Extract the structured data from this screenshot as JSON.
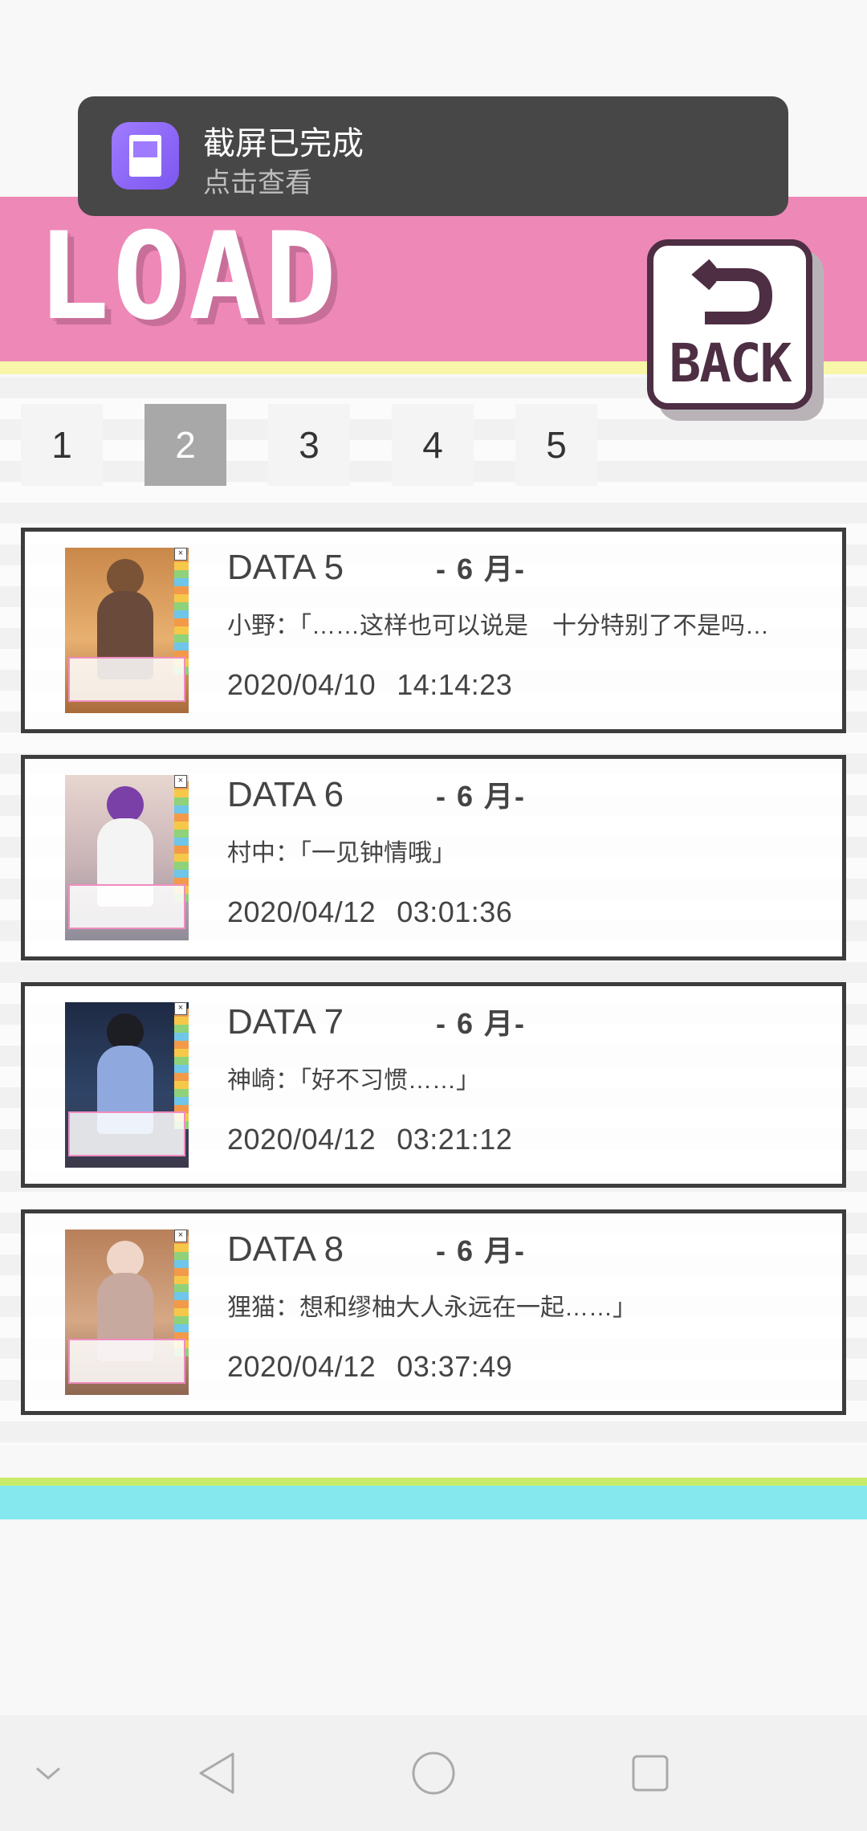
{
  "screen": {
    "title": "LOAD",
    "back_label": "BACK"
  },
  "notification": {
    "title": "截屏已完成",
    "subtitle": "点击查看"
  },
  "pages": {
    "tabs": [
      "1",
      "2",
      "3",
      "4",
      "5"
    ],
    "active": "2"
  },
  "slots": [
    {
      "title": "DATA 5",
      "chapter": "- 6 月-",
      "line": "小野：「……这样也可以说是　十分特别了不是吗…",
      "date": "2020/04/10",
      "time": "14:14:23"
    },
    {
      "title": "DATA 6",
      "chapter": "- 6 月-",
      "line": "村中：「一见钟情哦」",
      "date": "2020/04/12",
      "time": "03:01:36"
    },
    {
      "title": "DATA 7",
      "chapter": "- 6 月-",
      "line": "神崎：「好不习惯……」",
      "date": "2020/04/12",
      "time": "03:21:12"
    },
    {
      "title": "DATA 8",
      "chapter": "- 6 月-",
      "line": "狸猫：想和缪柚大人永远在一起……」",
      "date": "2020/04/12",
      "time": "03:37:49"
    }
  ],
  "icons": {
    "nav": [
      "collapse-chevron-icon",
      "back-triangle-icon",
      "home-circle-icon",
      "recents-square-icon"
    ],
    "toast": "screenshot-gallery-icon",
    "back": "return-arrow-icon"
  },
  "colors": {
    "header_pink": "#ee88b7",
    "accent_yellow": "#f8f6a8",
    "back_border": "#4d2e43",
    "active_tab": "#a8a8a8",
    "bottom_cyan": "#84e8ee",
    "bottom_green": "#c8ec6a",
    "toast_bg": "#474747"
  }
}
